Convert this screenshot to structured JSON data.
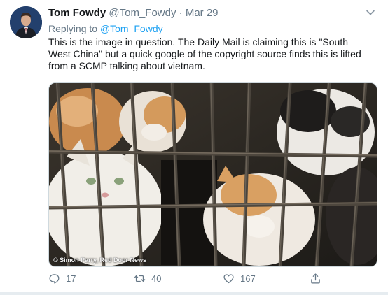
{
  "tweet": {
    "author": {
      "display_name": "Tom Fowdy",
      "handle": "@Tom_Fowdy",
      "separator": "·",
      "date": "Mar 29",
      "avatar_icon": "user-avatar"
    },
    "reply": {
      "prefix": "Replying to",
      "mention": "@Tom_Fowdy"
    },
    "text": "This is the image in question. The Daily Mail is claiming this is \"South West China\" but a quick google of the copyright source finds this is lifted from a SCMP talking about vietnam.",
    "media": {
      "credit": "© Simon Parry, Red Door News"
    },
    "actions": {
      "reply_count": "17",
      "retweet_count": "40",
      "like_count": "167"
    },
    "icons": [
      "chevron-down-icon",
      "reply-icon",
      "retweet-icon",
      "like-icon",
      "share-icon"
    ],
    "colors": {
      "link": "#1da1f2",
      "muted": "#657786",
      "text": "#14171a"
    }
  }
}
